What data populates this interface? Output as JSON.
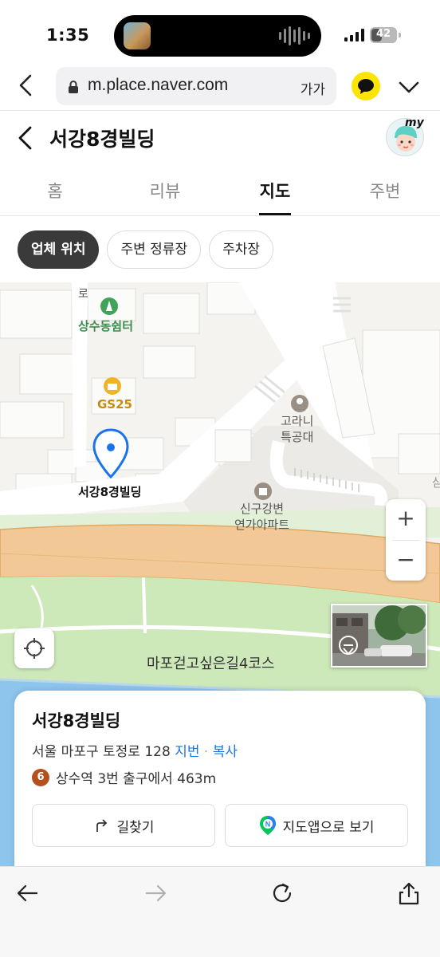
{
  "status_bar": {
    "time": "1:35",
    "battery": "42"
  },
  "browser": {
    "url": "m.place.naver.com",
    "text_size": "가가"
  },
  "place": {
    "title": "서강8경빌딩",
    "profile_badge": "my"
  },
  "tabs": [
    "홈",
    "리뷰",
    "지도",
    "주변"
  ],
  "active_tab": "지도",
  "chips": [
    "업체 위치",
    "주변 정류장",
    "주차장"
  ],
  "map": {
    "labels": {
      "park": "상수동쉼터",
      "store": "GS25",
      "pin": "서강8경빌딩",
      "school": "고라니\n특공대",
      "apartment": "신구강변\n연가아파트",
      "trail": "마포걷고싶은길4코스",
      "road_fragment": "로",
      "edge_fragment": "삼"
    },
    "zoom_in": "+",
    "zoom_out": "−"
  },
  "info_card": {
    "name": "서강8경빌딩",
    "address": "서울 마포구 토정로 128",
    "address_link": "지번",
    "copy_link": "복사",
    "subway_line": "6",
    "subway_text": "상수역 3번 출구에서 463m",
    "directions_button": "길찾기",
    "map_app_button": "지도앱으로 보기"
  },
  "colors": {
    "river_road": "#f2c996",
    "park_green": "#cde8b9",
    "water": "#8ec5ec",
    "pin_blue": "#1a73e8",
    "accent_yellow": "#fee500"
  }
}
